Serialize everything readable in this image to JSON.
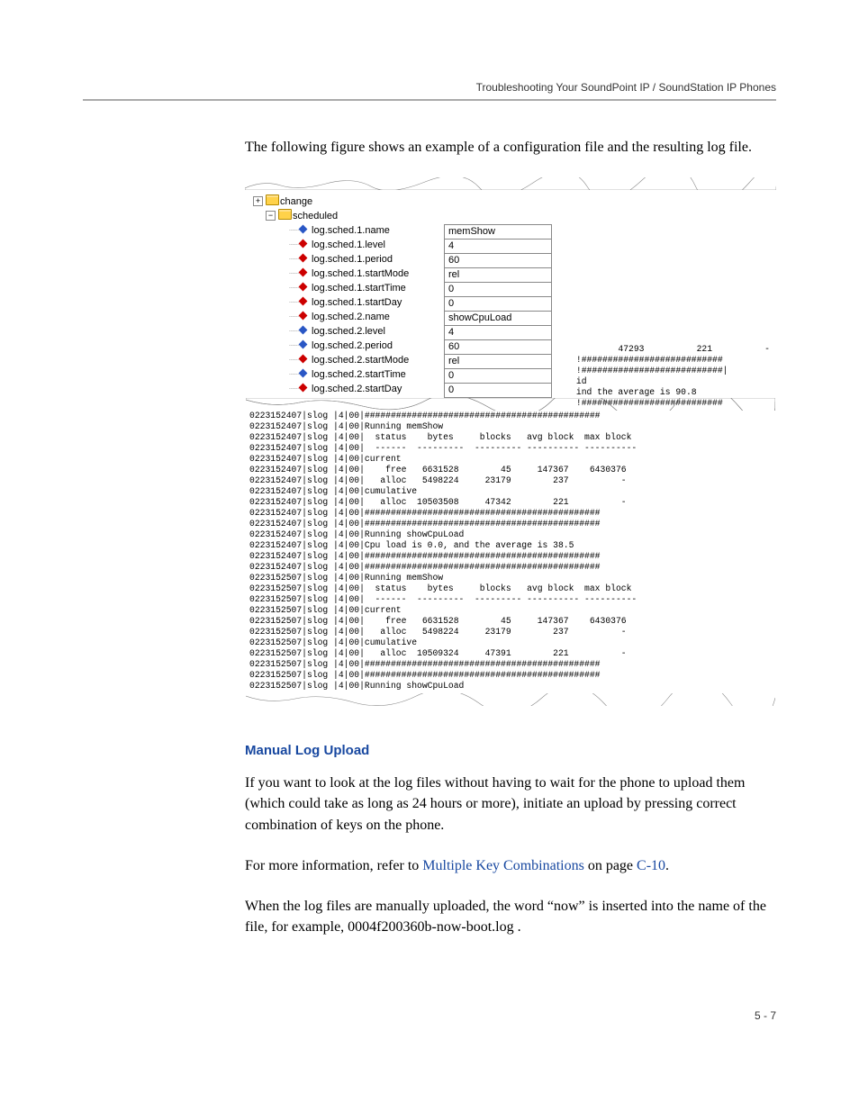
{
  "running_head": "Troubleshooting Your SoundPoint IP / SoundStation IP Phones",
  "intro": "The following figure shows an example of a configuration file and the resulting log file.",
  "config_tree": {
    "top_node": "change",
    "parent": "scheduled",
    "rows": [
      {
        "name": "log.sched.1.name",
        "val": "memShow",
        "diamond": "blue"
      },
      {
        "name": "log.sched.1.level",
        "val": "4",
        "diamond": "red"
      },
      {
        "name": "log.sched.1.period",
        "val": "60",
        "diamond": "red"
      },
      {
        "name": "log.sched.1.startMode",
        "val": "rel",
        "diamond": "red"
      },
      {
        "name": "log.sched.1.startTime",
        "val": "0",
        "diamond": "red"
      },
      {
        "name": "log.sched.1.startDay",
        "val": "0",
        "diamond": "red"
      },
      {
        "name": "log.sched.2.name",
        "val": "showCpuLoad",
        "diamond": "red"
      },
      {
        "name": "log.sched.2.level",
        "val": "4",
        "diamond": "blue"
      },
      {
        "name": "log.sched.2.period",
        "val": "60",
        "diamond": "blue"
      },
      {
        "name": "log.sched.2.startMode",
        "val": "rel",
        "diamond": "red"
      },
      {
        "name": "log.sched.2.startTime",
        "val": "0",
        "diamond": "blue"
      },
      {
        "name": "log.sched.2.startDay",
        "val": "0",
        "diamond": "red"
      }
    ]
  },
  "log_overlay": "        47293          221          -\n!###########################\n!###########################|\nid\nind the average is 90.8\n!###########################",
  "log_lines": [
    "0223152407|slog |4|00|#############################################",
    "0223152407|slog |4|00|Running memShow",
    "0223152407|slog |4|00|  status    bytes     blocks   avg block  max block",
    "0223152407|slog |4|00|  ------  ---------  --------- ---------- ----------",
    "0223152407|slog |4|00|current",
    "0223152407|slog |4|00|    free   6631528        45     147367    6430376",
    "0223152407|slog |4|00|   alloc   5498224     23179        237          -",
    "0223152407|slog |4|00|cumulative",
    "0223152407|slog |4|00|   alloc  10503508     47342        221          -",
    "0223152407|slog |4|00|#############################################",
    "0223152407|slog |4|00|#############################################",
    "0223152407|slog |4|00|Running showCpuLoad",
    "0223152407|slog |4|00|Cpu load is 0.0, and the average is 38.5",
    "0223152407|slog |4|00|#############################################",
    "0223152407|slog |4|00|#############################################",
    "0223152507|slog |4|00|Running memShow",
    "0223152507|slog |4|00|  status    bytes     blocks   avg block  max block",
    "0223152507|slog |4|00|  ------  ---------  --------- ---------- ----------",
    "0223152507|slog |4|00|current",
    "0223152507|slog |4|00|    free   6631528        45     147367    6430376",
    "0223152507|slog |4|00|   alloc   5498224     23179        237          -",
    "0223152507|slog |4|00|cumulative",
    "0223152507|slog |4|00|   alloc  10509324     47391        221          -",
    "0223152507|slog |4|00|#############################################",
    "0223152507|slog |4|00|#############################################",
    "0223152507|slog |4|00|Running showCpuLoad"
  ],
  "section_heading": "Manual Log Upload",
  "para1": "If you want to look at the log files without having to wait for the phone to upload them (which could take as long as 24 hours or more), initiate an upload by pressing correct combination of keys on the phone.",
  "para2_pre": "For more information, refer to ",
  "para2_link": "Multiple Key Combinations",
  "para2_mid": " on page ",
  "para2_page": "C-10",
  "para2_post": ".",
  "para3": "When the log files are manually uploaded, the word “now” is inserted into the name of the file, for example, 0004f200360b-now-boot.log .",
  "page_number": "5 - 7"
}
